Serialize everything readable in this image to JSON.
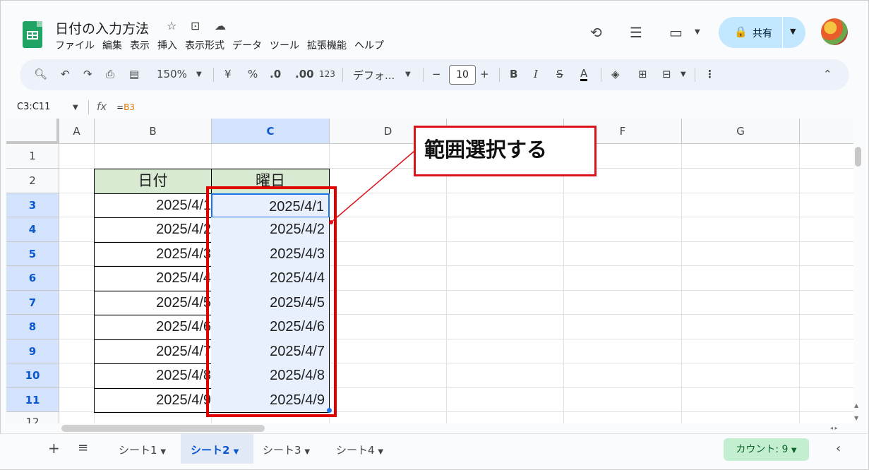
{
  "app": {
    "doc_title": "日付の入力方法",
    "menu": [
      "ファイル",
      "編集",
      "表示",
      "挿入",
      "表示形式",
      "データ",
      "ツール",
      "拡張機能",
      "ヘルプ"
    ],
    "share_label": "共有"
  },
  "toolbar": {
    "zoom": "150%",
    "currency": "¥",
    "percent": "%",
    "dec_decrease": ".0",
    "dec_increase": ".00",
    "number_format": "123",
    "font": "デフォ...",
    "font_size": "10",
    "bold": "B",
    "italic": "I",
    "strike": "S",
    "text_color": "A"
  },
  "formula_bar": {
    "name_box": "C3:C11",
    "fx": "fx",
    "formula_prefix": "=",
    "formula_ref": "B3"
  },
  "sheet": {
    "columns": [
      "A",
      "B",
      "C",
      "D",
      "E",
      "F",
      "G"
    ],
    "selected_column": "C",
    "rows": [
      "1",
      "2",
      "3",
      "4",
      "5",
      "6",
      "7",
      "8",
      "9",
      "10",
      "11",
      "12"
    ],
    "selected_rows": [
      "3",
      "4",
      "5",
      "6",
      "7",
      "8",
      "9",
      "10",
      "11"
    ],
    "header_b": "日付",
    "header_c": "曜日",
    "col_b_values": [
      "2025/4/1",
      "2025/4/2",
      "2025/4/3",
      "2025/4/4",
      "2025/4/5",
      "2025/4/6",
      "2025/4/7",
      "2025/4/8",
      "2025/4/9"
    ],
    "col_c_values": [
      "2025/4/1",
      "2025/4/2",
      "2025/4/3",
      "2025/4/4",
      "2025/4/5",
      "2025/4/6",
      "2025/4/7",
      "2025/4/8",
      "2025/4/9"
    ]
  },
  "annotation": {
    "callout_text": "範囲選択する",
    "color": "#e00000"
  },
  "bottom_bar": {
    "tabs": [
      "シート1",
      "シート2",
      "シート3",
      "シート4"
    ],
    "active_tab": "シート2",
    "count_label": "カウント: 9"
  },
  "colors": {
    "accent": "#0b57d0",
    "selection": "#e8f0fe",
    "header_fill": "#d9ead3",
    "share_bg": "#c2e7ff",
    "count_bg": "#c4eed0"
  }
}
